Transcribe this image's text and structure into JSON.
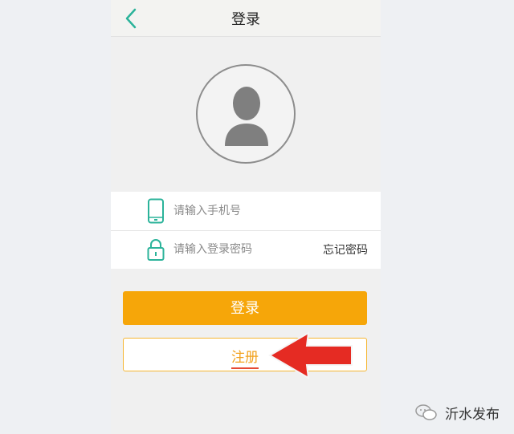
{
  "header": {
    "title": "登录",
    "back_icon": "chevron-left-icon"
  },
  "avatar": {
    "icon": "user-silhouette-icon"
  },
  "form": {
    "phone_placeholder": "请输入手机号",
    "phone_icon": "phone-icon",
    "password_placeholder": "请输入登录密码",
    "password_icon": "lock-icon",
    "forgot_label": "忘记密码"
  },
  "actions": {
    "login_label": "登录",
    "register_label": "注册"
  },
  "annotation": {
    "icon": "red-arrow-pointer-icon"
  },
  "watermark": {
    "text": "沂水发布",
    "icon": "wechat-icon"
  },
  "colors": {
    "accent_teal": "#2bb39a",
    "login_orange": "#f6a609",
    "register_text": "#f2a21d",
    "arrow_red": "#e52b23"
  }
}
